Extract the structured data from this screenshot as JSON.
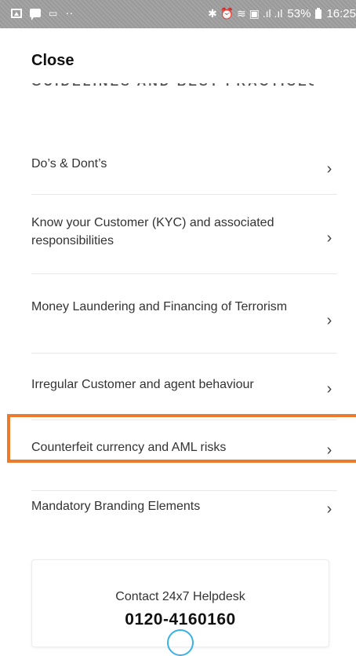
{
  "status_bar": {
    "dots": "··",
    "icons": [
      "image-icon",
      "message-icon",
      "sim-icon",
      "bluetooth-icon",
      "alarm-icon",
      "wifi-icon",
      "signal-icon",
      "battery-icon"
    ],
    "glyphs": "✱ ⏰ ≋ ▣ .ıl .ıl",
    "battery": "53%",
    "time": "16:25"
  },
  "header": {
    "close_label": "Close"
  },
  "section": {
    "title_partial": "GUIDELINES AND BEST PRACTICES"
  },
  "menu": {
    "items": [
      {
        "label": "Do’s & Dont’s",
        "chevron": "›"
      },
      {
        "label": "Know your Customer (KYC) and associated responsibilities",
        "chevron": "›"
      },
      {
        "label": "Money Laundering and Financing of Terrorism",
        "chevron": "›"
      },
      {
        "label": "Irregular Customer and agent behaviour",
        "chevron": "›"
      },
      {
        "label": "Counterfeit currency and AML risks",
        "chevron": "›"
      },
      {
        "label": "Mandatory Branding Elements",
        "chevron": "›"
      }
    ],
    "highlighted_index": 4,
    "highlight_color": "#ec7a2d"
  },
  "helpdesk": {
    "title": "Contact 24x7 Helpdesk",
    "phone": "0120-4160160",
    "accent": "#39b0e6"
  }
}
